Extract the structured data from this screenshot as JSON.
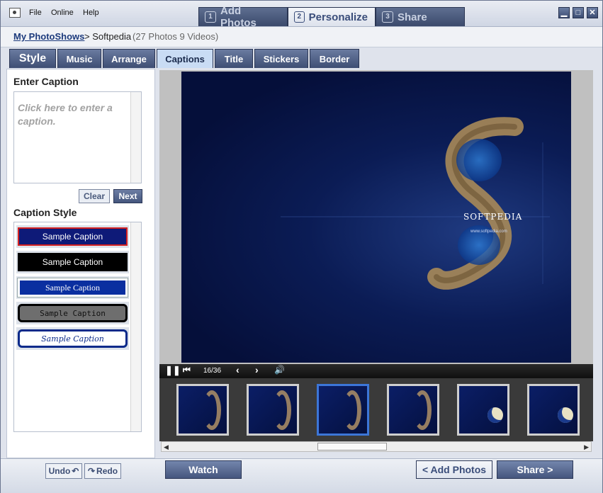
{
  "menu": {
    "file": "File",
    "online": "Online",
    "help": "Help"
  },
  "steps": [
    {
      "num": "1",
      "label": "Add Photos"
    },
    {
      "num": "2",
      "label": "Personalize"
    },
    {
      "num": "3",
      "label": "Share"
    }
  ],
  "breadcrumb": {
    "link": "My PhotoShows",
    "current": "> Softpedia",
    "count": "(27 Photos 9 Videos)"
  },
  "tabs": [
    "Style",
    "Music",
    "Arrange",
    "Captions",
    "Title",
    "Stickers",
    "Border"
  ],
  "caption": {
    "heading": "Enter Caption",
    "placeholder": "Click here to enter a caption.",
    "clear_label": "Clear",
    "next_label": "Next"
  },
  "caption_style": {
    "heading": "Caption Style",
    "samples": [
      "Sample Caption",
      "Sample Caption",
      "Sample Caption",
      "Sample Caption",
      "Sample Caption"
    ]
  },
  "player": {
    "counter": "16/36"
  },
  "photo": {
    "title": "SOFTPEDIA",
    "url": "www.softpedia.com"
  },
  "bottom": {
    "undo_label": "Undo",
    "redo_label": "Redo",
    "watch_label": "Watch",
    "add_photos_label": "< Add Photos",
    "share_label": "Share >"
  }
}
